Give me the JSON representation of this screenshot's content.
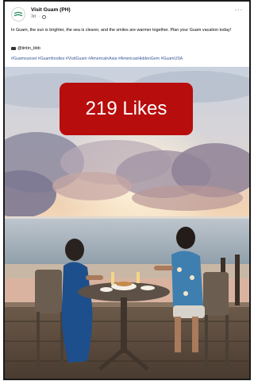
{
  "post": {
    "page_name": "Visit Guam (PH)",
    "time": "3d",
    "more_label": "···",
    "caption": "In Guam, the sun is brighter, the sea is clearer, and the smiles are warmer together. Plan your Guam vacation today!",
    "credit": "@tintin_bbb",
    "hashtags": "#Guamsunset #Guamfoodies #VisitGuam #AmericaInAsia #AmericasHiddenGem #GuamUSA",
    "link_color": "#385898"
  },
  "overlay": {
    "likes_label": "219 Likes",
    "badge_color": "#b80d0d"
  },
  "icons": {
    "avatar": "visit-guam-logo-icon",
    "audience": "globe-icon",
    "credit": "camera-icon",
    "more": "more-options-icon"
  }
}
